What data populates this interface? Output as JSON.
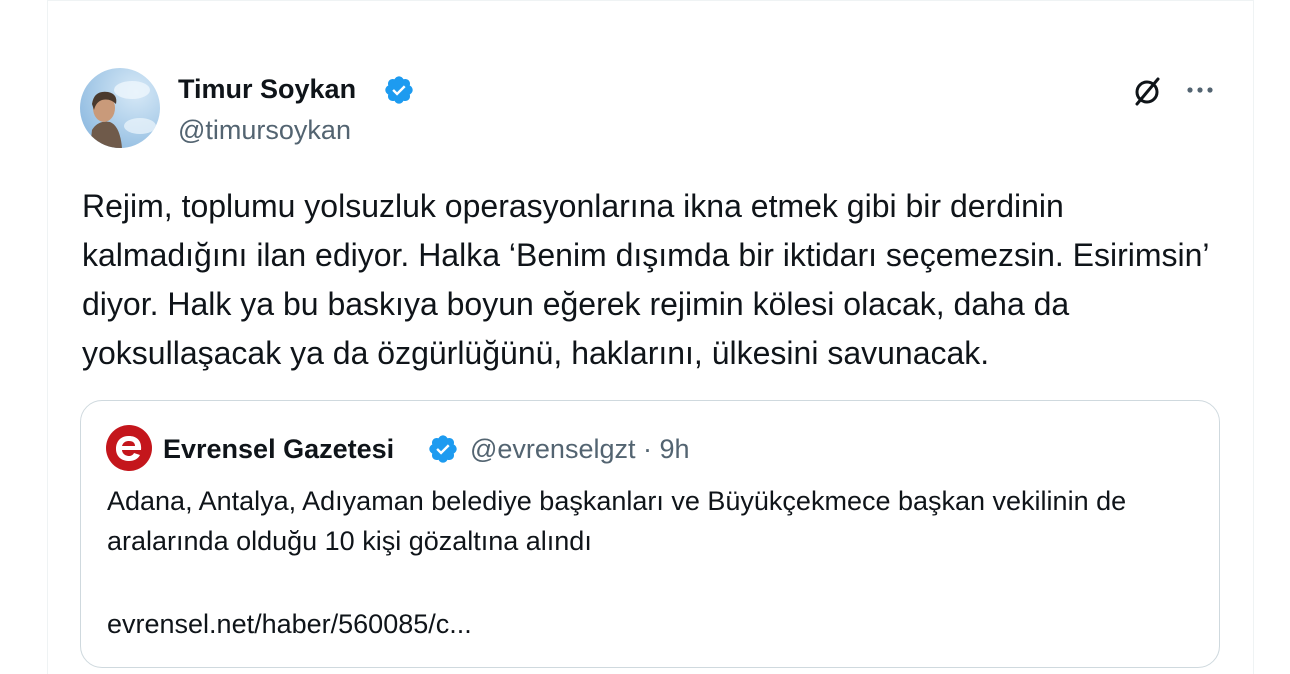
{
  "author": {
    "name": "Timur Soykan",
    "handle": "@timursoykan",
    "verified_color": "#1d9bf0"
  },
  "icons": {
    "grok": "grok-icon",
    "more": "more-icon"
  },
  "tweet": {
    "text": "Rejim, toplumu yolsuzluk operasyonlarına ikna etmek gibi bir derdinin kalmadığını ilan ediyor. Halka ‘Benim dışımda bir iktidarı seçemezsin. Esirimsin’ diyor. Halk ya bu baskıya boyun eğerek rejimin kölesi olacak, daha da yoksullaşacak ya da özgürlüğünü, haklarını, ülkesini savunacak."
  },
  "quote": {
    "name": "Evrensel Gazetesi",
    "meta": "@evrenselgzt · 9h",
    "text": "Adana, Antalya, Adıyaman belediye başkanları ve Büyükçekmece başkan vekilinin de aralarında olduğu 10 kişi gözaltına alındı",
    "link": "evrensel.net/haber/560085/c...",
    "logo_color": "#c4161c"
  }
}
